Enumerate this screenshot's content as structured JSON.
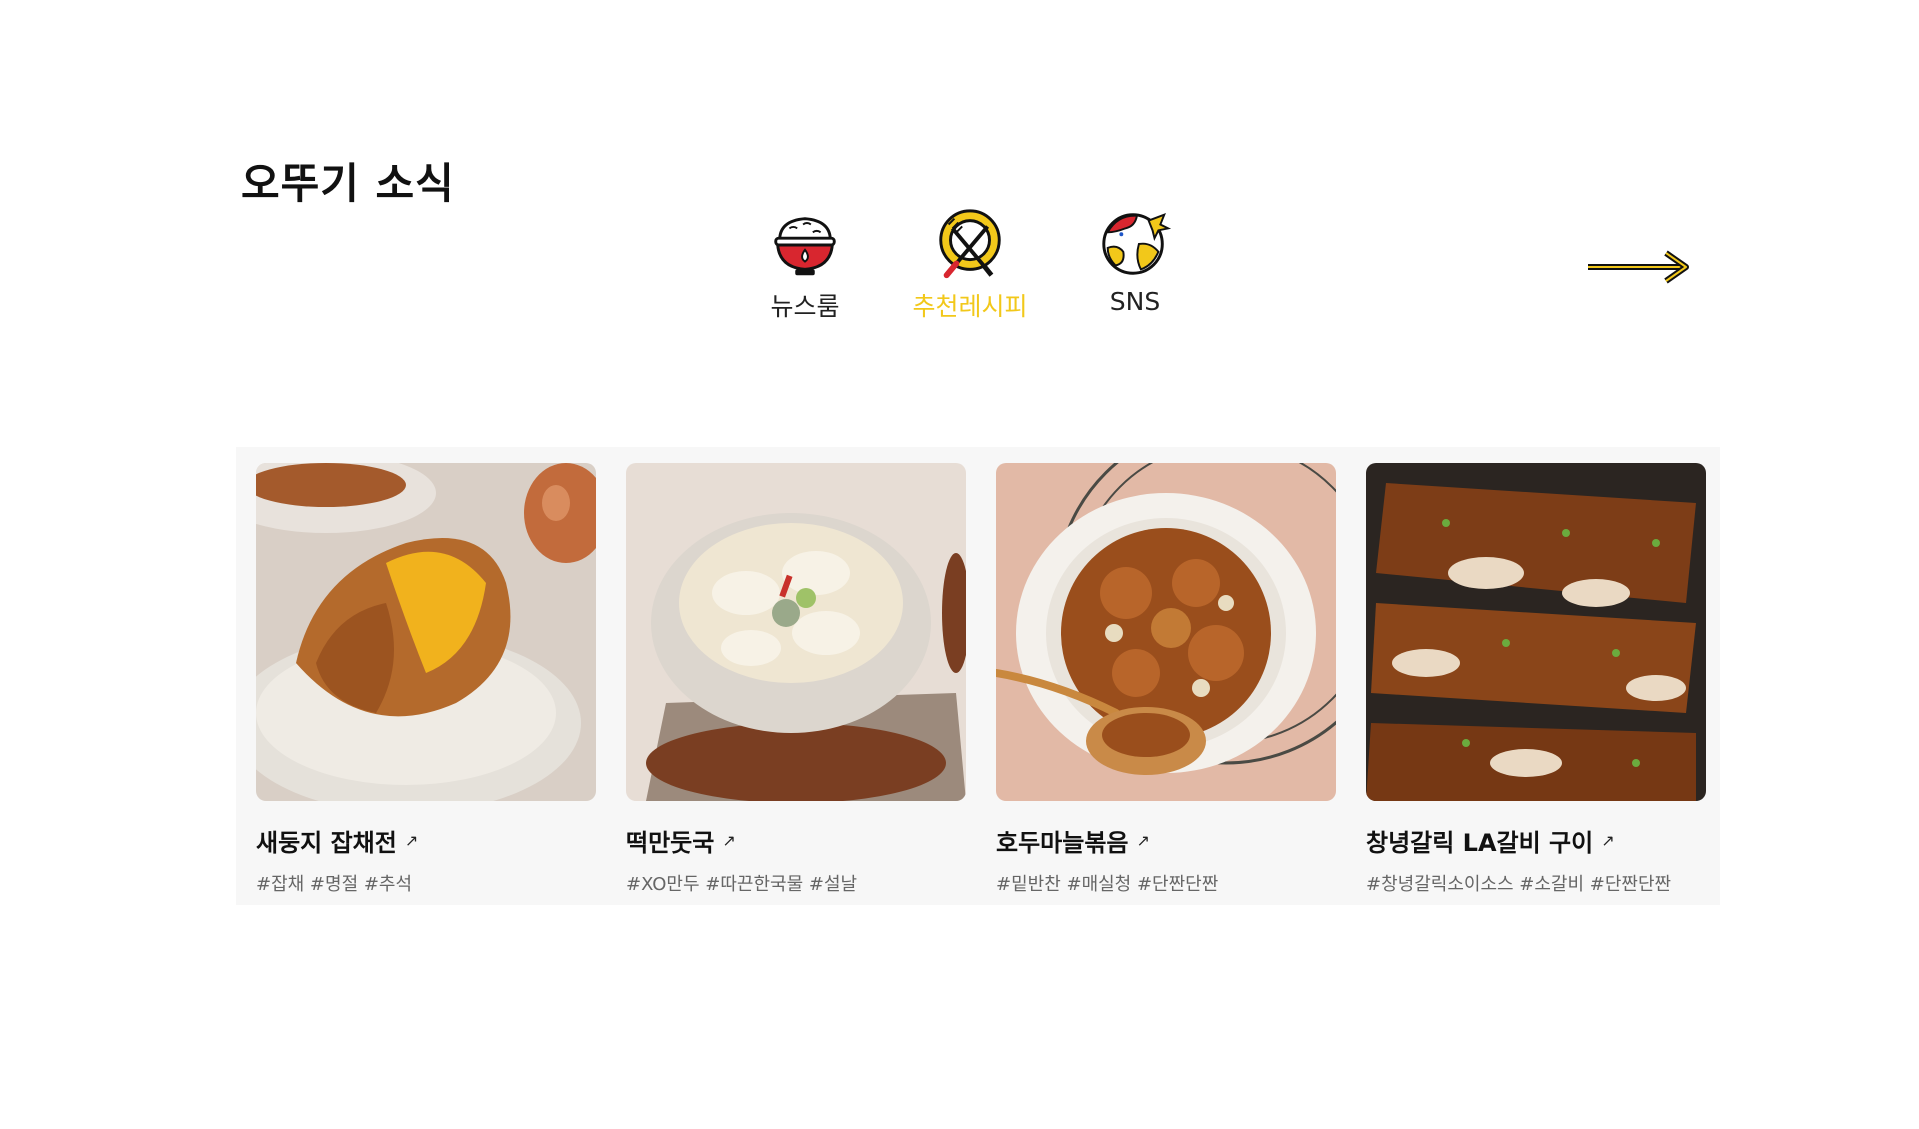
{
  "section": {
    "title": "오뚜기 소식"
  },
  "tabs": [
    {
      "label": "뉴스룸",
      "icon": "rice-bowl-icon",
      "active": false
    },
    {
      "label": "추천레시피",
      "icon": "plate-fork-knife-icon",
      "active": true
    },
    {
      "label": "SNS",
      "icon": "globe-icon",
      "active": false
    }
  ],
  "nav": {
    "next_icon": "arrow-right-icon"
  },
  "cards": [
    {
      "title": "새둥지 잡채전",
      "link_icon": "↗",
      "tags": "#잡채 #명절 #추석",
      "image": "japchae-pancake-photo"
    },
    {
      "title": "떡만둣국",
      "link_icon": "↗",
      "tags": "#XO만두 #따끈한국물 #설날",
      "image": "dumpling-soup-photo"
    },
    {
      "title": "호두마늘볶음",
      "link_icon": "↗",
      "tags": "#밑반찬 #매실청 #단짠단짠",
      "image": "walnut-garlic-photo"
    },
    {
      "title": "창녕갈릭 LA갈비 구이",
      "link_icon": "↗",
      "tags": "#창녕갈릭소이소스 #소갈비 #단짠단짠",
      "image": "la-galbi-photo"
    }
  ],
  "colors": {
    "accent": "#f2c81a",
    "panel_bg": "#f7f7f7",
    "bowl_red": "#d8262f"
  }
}
